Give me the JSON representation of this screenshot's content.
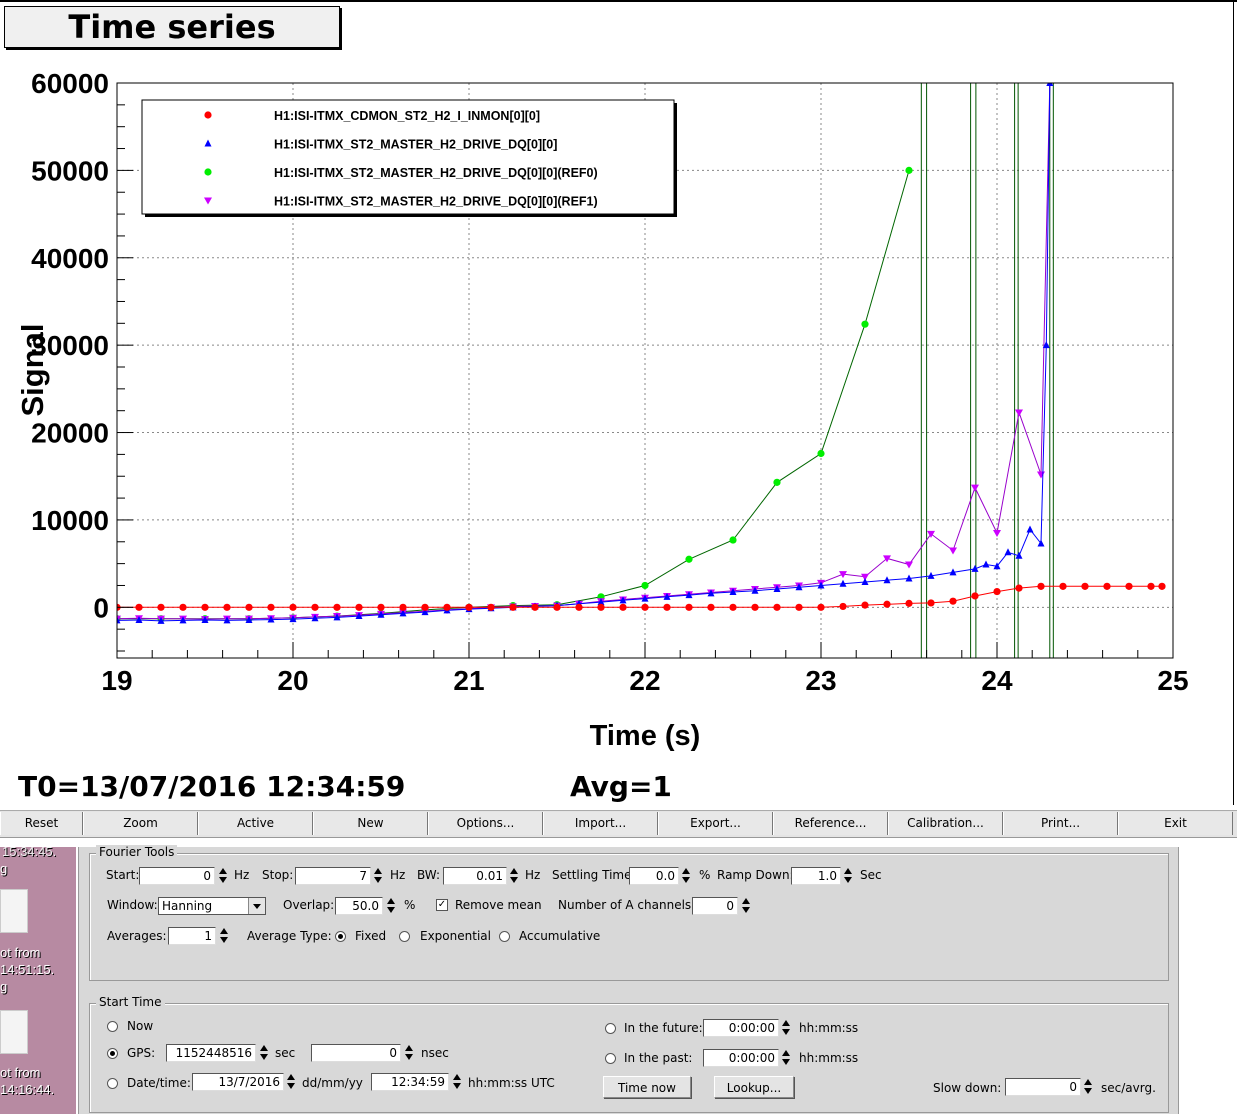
{
  "plot": {
    "title": "Time series",
    "t0": "T0=13/07/2016 12:34:59",
    "avg": "Avg=1"
  },
  "chart_data": {
    "type": "line",
    "title": "Time series",
    "xlabel": "Time (s)",
    "ylabel": "Signal",
    "xlim": [
      19,
      25
    ],
    "ylim": [
      -5800,
      60000
    ],
    "xticks": [
      19,
      20,
      21,
      22,
      23,
      24,
      25
    ],
    "yticks": [
      0,
      10000,
      20000,
      30000,
      40000,
      50000,
      60000
    ],
    "ytick_labels": [
      "0",
      "10000",
      "20000",
      "30000",
      "40000",
      "50000",
      "60000"
    ],
    "grid": true,
    "legend_position": "top-left",
    "series": [
      {
        "name": "H1:ISI-ITMX_CDMON_ST2_H2_I_INMON[0][0]",
        "color": "#ff0000",
        "marker": "circle",
        "x": [
          19.0,
          19.125,
          19.25,
          19.375,
          19.5,
          19.625,
          19.75,
          19.875,
          20.0,
          20.125,
          20.25,
          20.375,
          20.5,
          20.625,
          20.75,
          20.875,
          21.0,
          21.125,
          21.25,
          21.375,
          21.5,
          21.625,
          21.75,
          21.875,
          22.0,
          22.125,
          22.25,
          22.375,
          22.5,
          22.625,
          22.75,
          22.875,
          23.0,
          23.125,
          23.25,
          23.375,
          23.5,
          23.625,
          23.75,
          23.875,
          24.0,
          24.125,
          24.25,
          24.375,
          24.5,
          24.625,
          24.75,
          24.875,
          24.9375
        ],
        "y": [
          0,
          0,
          0,
          0,
          0,
          0,
          0,
          0,
          0,
          0,
          0,
          0,
          0,
          0,
          0,
          0,
          0,
          0,
          0,
          0,
          0,
          0,
          0,
          0,
          0,
          0,
          0,
          0,
          0,
          0,
          0,
          0,
          0,
          100,
          250,
          350,
          450,
          500,
          700,
          1300,
          1800,
          2200,
          2400,
          2400,
          2400,
          2400,
          2400,
          2400,
          2400
        ]
      },
      {
        "name": "H1:ISI-ITMX_ST2_MASTER_H2_DRIVE_DQ[0][0]",
        "color": "#0000ff",
        "marker": "triangle-up",
        "x": [
          19.0,
          19.125,
          19.25,
          19.375,
          19.5,
          19.625,
          19.75,
          19.875,
          20.0,
          20.125,
          20.25,
          20.375,
          20.5,
          20.625,
          20.75,
          20.875,
          21.0,
          21.125,
          21.25,
          21.375,
          21.5,
          21.625,
          21.75,
          21.875,
          22.0,
          22.125,
          22.25,
          22.375,
          22.5,
          22.625,
          22.75,
          22.875,
          23.0,
          23.125,
          23.25,
          23.375,
          23.5,
          23.625,
          23.75,
          23.875,
          23.9375,
          24.0,
          24.0625,
          24.125,
          24.1875,
          24.25,
          24.28,
          24.3
        ],
        "y": [
          -1500,
          -1450,
          -1550,
          -1500,
          -1450,
          -1500,
          -1450,
          -1400,
          -1350,
          -1250,
          -1150,
          -1000,
          -850,
          -700,
          -550,
          -350,
          -200,
          -100,
          0,
          100,
          200,
          400,
          600,
          800,
          1000,
          1200,
          1400,
          1600,
          1750,
          1900,
          2100,
          2300,
          2500,
          2700,
          2900,
          3100,
          3300,
          3600,
          4000,
          4400,
          4900,
          4700,
          6300,
          5900,
          8900,
          7300,
          30000,
          60000
        ]
      },
      {
        "name": "H1:ISI-ITMX_ST2_MASTER_H2_DRIVE_DQ[0][0](REF0)",
        "color": "#00ee00",
        "marker": "circle",
        "x": [
          19.0,
          19.25,
          19.5,
          19.75,
          20.0,
          20.25,
          20.5,
          20.75,
          21.0,
          21.25,
          21.5,
          21.75,
          22.0,
          22.25,
          22.5,
          22.75,
          23.0,
          23.25,
          23.5
        ],
        "y": [
          -1300,
          -1300,
          -1300,
          -1300,
          -1200,
          -1000,
          -700,
          -300,
          0,
          200,
          300,
          1200,
          2500,
          5500,
          7700,
          14300,
          17600,
          32400,
          50000
        ]
      },
      {
        "name": "H1:ISI-ITMX_ST2_MASTER_H2_DRIVE_DQ[0][0](REF1)",
        "color": "#cc00ff",
        "marker": "triangle-down",
        "x": [
          19.0,
          19.125,
          19.25,
          19.375,
          19.5,
          19.625,
          19.75,
          19.875,
          20.0,
          20.125,
          20.25,
          20.375,
          20.5,
          20.625,
          20.75,
          20.875,
          21.0,
          21.125,
          21.25,
          21.375,
          21.5,
          21.625,
          21.75,
          21.875,
          22.0,
          22.125,
          22.25,
          22.375,
          22.5,
          22.625,
          22.75,
          22.875,
          23.0,
          23.125,
          23.25,
          23.375,
          23.5,
          23.625,
          23.75,
          23.875,
          24.0,
          24.125,
          24.25,
          24.3
        ],
        "y": [
          -1300,
          -1250,
          -1300,
          -1300,
          -1350,
          -1300,
          -1300,
          -1250,
          -1200,
          -1100,
          -1000,
          -900,
          -750,
          -600,
          -450,
          -300,
          -150,
          0,
          100,
          150,
          200,
          400,
          700,
          900,
          1100,
          1300,
          1500,
          1700,
          1900,
          2100,
          2300,
          2500,
          2800,
          3800,
          3500,
          5600,
          4900,
          8400,
          6500,
          13700,
          8500,
          22300,
          15200,
          60000
        ]
      }
    ],
    "ref0_vertical_lines_x": [
      23.57,
      23.6,
      23.85,
      23.88,
      24.1,
      24.12,
      24.3,
      24.32
    ]
  },
  "toolbar": {
    "buttons": [
      "Reset",
      "Zoom",
      "Active",
      "New",
      "Options...",
      "Import...",
      "Export...",
      "Reference...",
      "Calibration...",
      "Print...",
      "Exit"
    ]
  },
  "desktop": {
    "top_text": "15:34:45.",
    "line1": "g",
    "item1_line1": "ot from",
    "item1_line2": "14:51:15.",
    "item1_line3": "g",
    "item2_line1": "ot from",
    "item2_line2": "14:16:44."
  },
  "fourier": {
    "title": "Fourier Tools",
    "start_label": "Start:",
    "start_value": "0",
    "start_unit": "Hz",
    "stop_label": "Stop:",
    "stop_value": "7",
    "stop_unit": "Hz",
    "bw_label": "BW:",
    "bw_value": "0.01",
    "bw_unit": "Hz",
    "settling_label": "Settling Time:",
    "settling_value": "0.0",
    "settling_unit": "%",
    "ramp_label": "Ramp Down:",
    "ramp_value": "1.0",
    "ramp_unit": "Sec",
    "window_label": "Window:",
    "window_value": "Hanning",
    "overlap_label": "Overlap:",
    "overlap_value": "50.0",
    "overlap_unit": "%",
    "remove_mean_label": "Remove mean",
    "num_a_label": "Number of A channels:",
    "num_a_value": "0",
    "averages_label": "Averages:",
    "averages_value": "1",
    "avg_type_label": "Average Type:",
    "avg_fixed": "Fixed",
    "avg_exp": "Exponential",
    "avg_accum": "Accumulative"
  },
  "start_time": {
    "title": "Start Time",
    "now_label": "Now",
    "gps_label": "GPS:",
    "gps_value": "1152448516",
    "gps_unit": "sec",
    "nsec_value": "0",
    "nsec_unit": "nsec",
    "date_label": "Date/time:",
    "date_value": "13/7/2016",
    "date_unit": "dd/mm/yy",
    "time_value": "12:34:59",
    "time_unit": "hh:mm:ss  UTC",
    "future_label": "In the future:",
    "future_value": "0:00:00",
    "future_unit": "hh:mm:ss",
    "past_label": "In the past:",
    "past_value": "0:00:00",
    "past_unit": "hh:mm:ss",
    "time_now_button": "Time now",
    "lookup_button": "Lookup...",
    "slow_down_label": "Slow down:",
    "slow_down_value": "0",
    "slow_down_unit": "sec/avrg."
  }
}
